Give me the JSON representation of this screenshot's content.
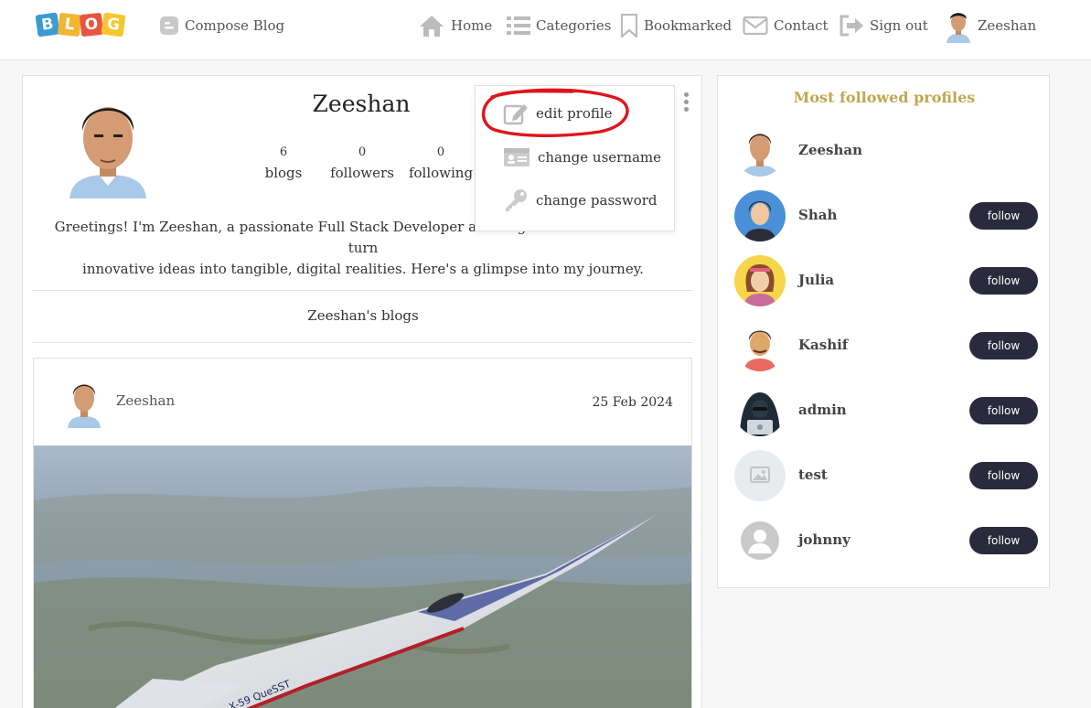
{
  "nav": {
    "logo_letters": [
      "B",
      "L",
      "O",
      "G"
    ],
    "compose": "Compose Blog",
    "home": "Home",
    "categories": "Categories",
    "bookmarked": "Bookmarked",
    "contact": "Contact",
    "signout": "Sign out",
    "user": "Zeeshan"
  },
  "profile": {
    "name": "Zeeshan",
    "stats": [
      {
        "value": "6",
        "label": "blogs"
      },
      {
        "value": "0",
        "label": "followers"
      },
      {
        "value": "0",
        "label": "following"
      }
    ],
    "bio_line1": "Greetings! I'm Zeeshan, a passionate Full Stack Developer and Engineer on a mission to turn",
    "bio_line2": "innovative ideas into tangible, digital realities. Here's a glimpse into my journey.",
    "blogs_heading": "Zeeshan's blogs"
  },
  "menu": {
    "edit": "edit profile",
    "username": "change username",
    "password": "change password"
  },
  "post": {
    "author": "Zeeshan",
    "date": "25 Feb 2024"
  },
  "sidebar": {
    "title": "Most followed profiles",
    "follow_label": "follow",
    "profiles": [
      {
        "name": "Zeeshan"
      },
      {
        "name": "Shah"
      },
      {
        "name": "Julia"
      },
      {
        "name": "Kashif"
      },
      {
        "name": "admin"
      },
      {
        "name": "test"
      },
      {
        "name": "johnny"
      }
    ]
  },
  "colors": {
    "accent_gold": "#c2a74f",
    "button_dark": "#2a2a3c",
    "highlight_red": "#e0141c"
  }
}
